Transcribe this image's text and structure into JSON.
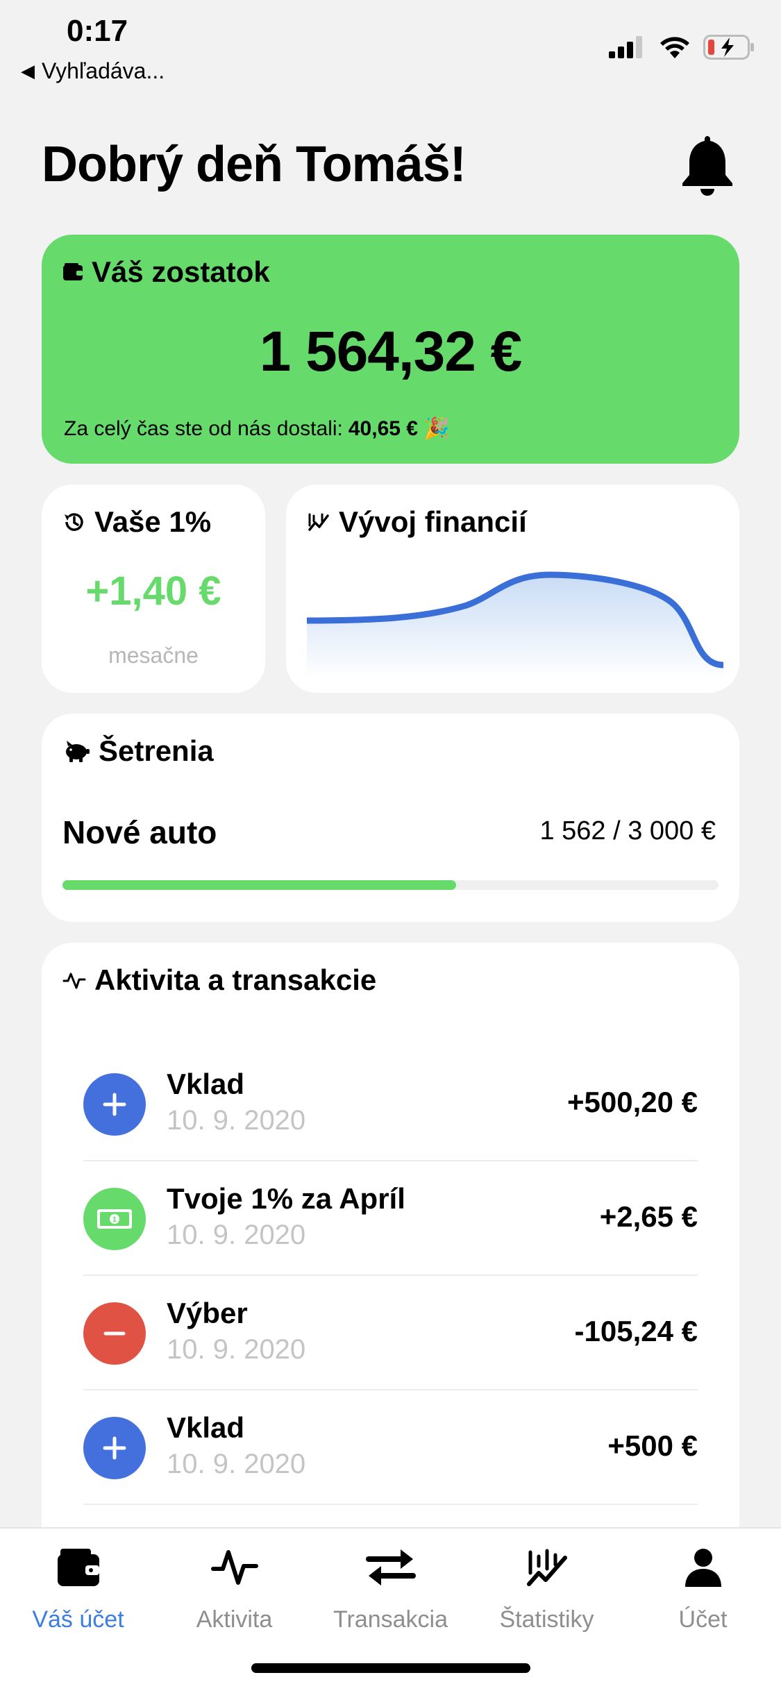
{
  "status_bar": {
    "time": "0:17",
    "back_label": "Vyhľadáva..."
  },
  "header": {
    "greeting": "Dobrý deň Tomáš!",
    "bell_icon": "bell-icon"
  },
  "balance": {
    "title": "Váš zostatok",
    "amount": "1 564,32 €",
    "note_prefix": "Za celý čas ste od nás dostali:",
    "note_value": "40,65 €",
    "note_emoji": "🎉",
    "color": "#66db6c"
  },
  "percent": {
    "title": "Vaše 1%",
    "value": "+1,40 €",
    "subtitle": "mesačne"
  },
  "finance": {
    "title": "Vývoj financií",
    "line_color": "#3b6fd8"
  },
  "savings": {
    "title": "Šetrenia",
    "goal_name": "Nové auto",
    "progress_text": "1 562 / 3 000 €",
    "progress_fraction": 0.6
  },
  "activity": {
    "title": "Aktivita a transakcie",
    "transactions": [
      {
        "title": "Vklad",
        "date": "10. 9. 2020",
        "amount": "+500,20 €",
        "type": "deposit"
      },
      {
        "title": "Tvoje 1% za Apríl",
        "date": "10. 9. 2020",
        "amount": "+2,65 €",
        "type": "reward"
      },
      {
        "title": "Výber",
        "date": "10. 9. 2020",
        "amount": "-105,24 €",
        "type": "withdrawal"
      },
      {
        "title": "Vklad",
        "date": "10. 9. 2020",
        "amount": "+500 €",
        "type": "deposit"
      }
    ]
  },
  "tab_bar": {
    "tabs": [
      {
        "label": "Váš účet",
        "icon": "wallet-icon",
        "active": true
      },
      {
        "label": "Aktivita",
        "icon": "activity-icon",
        "active": false
      },
      {
        "label": "Transakcia",
        "icon": "transfer-icon",
        "active": false
      },
      {
        "label": "Štatistiky",
        "icon": "stats-icon",
        "active": false
      },
      {
        "label": "Účet",
        "icon": "user-icon",
        "active": false
      }
    ],
    "active_color": "#3b7de0"
  }
}
